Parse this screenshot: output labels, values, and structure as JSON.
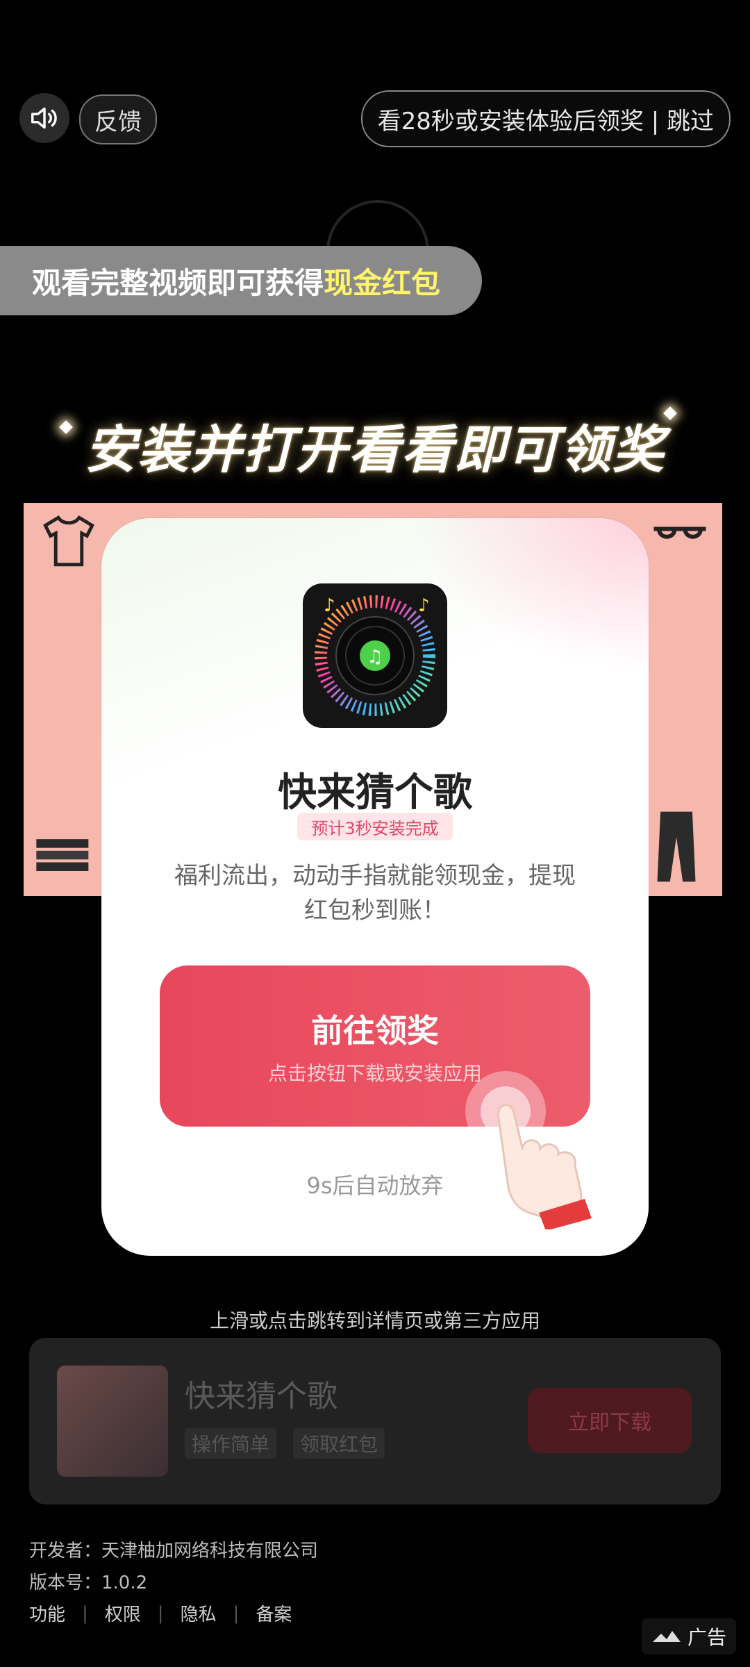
{
  "top": {
    "sound_icon": "speaker-icon",
    "feedback_label": "反馈",
    "skip_label": "看28秒或安装体验后领奖 | 跳过"
  },
  "banner": {
    "text": "观看完整视频即可获得",
    "highlight": "现金红包"
  },
  "headline": "安装并打开看看即可领奖",
  "modal": {
    "app_name": "快来猜个歌",
    "install_badge": "预计3秒安装完成",
    "description": "福利流出，动动手指就能领现金，提现红包秒到账！",
    "cta_title": "前往领奖",
    "cta_subtitle": "点击按钮下载或安装应用",
    "countdown": "9s后自动放弃"
  },
  "swipe_hint": "上滑或点击跳转到详情页或第三方应用",
  "ad_card": {
    "app_name": "快来猜个歌",
    "tags": [
      "操作简单",
      "领取红包"
    ],
    "download_label": "立即下载"
  },
  "footer": {
    "developer": "开发者：天津柚加网络科技有限公司",
    "version": "版本号：1.0.2",
    "links": [
      "功能",
      "权限",
      "隐私",
      "备案"
    ],
    "ad_label": "广告"
  }
}
